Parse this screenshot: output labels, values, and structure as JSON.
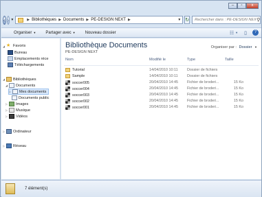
{
  "window": {
    "caption": {
      "minimize": "–",
      "maximize": "▫",
      "close": "x"
    }
  },
  "address_bar": {
    "crumbs": [
      "Bibliothèques",
      "Documents",
      "PE-DESIGN NEXT"
    ],
    "search_placeholder": "Rechercher dans : PE-DESIGN NEXT"
  },
  "toolbar": {
    "organize": "Organiser",
    "share": "Partager avec",
    "new_folder": "Nouveau dossier"
  },
  "nav": {
    "favorites": "Favoris",
    "desktop": "Bureau",
    "recent": "Emplacements réce",
    "downloads": "Téléchargements",
    "libraries": "Bibliothèques",
    "documents": "Documents",
    "my_documents": "Mes documents",
    "public_documents": "Documents public",
    "images": "Images",
    "music": "Musique",
    "videos": "Vidéos",
    "computer": "Ordinateur",
    "network": "Réseau"
  },
  "content": {
    "title": "Bibliothèque Documents",
    "subtitle": "PE-DESIGN NEXT",
    "arrange_label": "Organiser par :",
    "arrange_value": "Dossier",
    "columns": {
      "name": "Nom",
      "modified": "Modifié le",
      "type": "Type",
      "size": "Taille"
    },
    "files": [
      {
        "name": "Tutorial",
        "modified": "14/04/2010 10:11",
        "type": "Dossier de fichiers",
        "size": "",
        "kind": "folder"
      },
      {
        "name": "Sample",
        "modified": "14/04/2010 10:11",
        "type": "Dossier de fichiers",
        "size": "",
        "kind": "folder"
      },
      {
        "name": "soccer005",
        "modified": "20/04/2010 14:45",
        "type": "Fichier de broderi...",
        "size": "15 Ko",
        "kind": "embroidery"
      },
      {
        "name": "soccer004",
        "modified": "20/04/2010 14:45",
        "type": "Fichier de broderi...",
        "size": "15 Ko",
        "kind": "embroidery"
      },
      {
        "name": "soccer003",
        "modified": "20/04/2010 14:45",
        "type": "Fichier de broderi...",
        "size": "15 Ko",
        "kind": "embroidery"
      },
      {
        "name": "soccer002",
        "modified": "20/04/2010 14:45",
        "type": "Fichier de broderi...",
        "size": "15 Ko",
        "kind": "embroidery"
      },
      {
        "name": "soccer001",
        "modified": "20/04/2010 14:45",
        "type": "Fichier de broderi...",
        "size": "15 Ko",
        "kind": "embroidery"
      }
    ]
  },
  "details": {
    "item_count": "7 élément(s)"
  }
}
